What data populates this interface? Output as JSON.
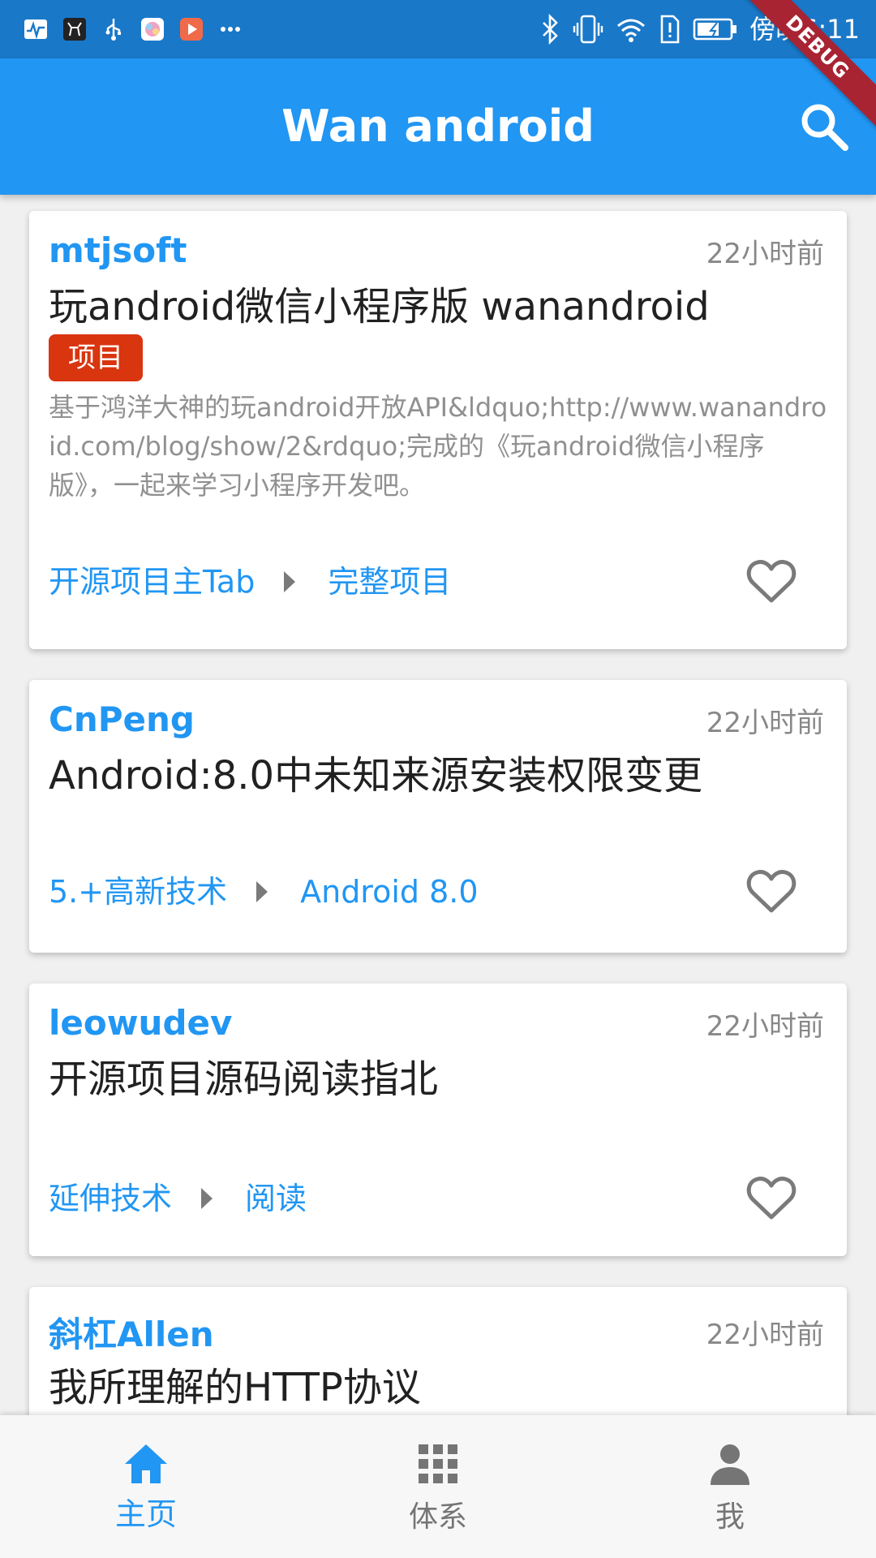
{
  "status_bar": {
    "time": "傍晚6:11",
    "left_icons": [
      "activity-monitor-icon",
      "app-icon",
      "usb-icon",
      "photos-icon",
      "video-icon",
      "more-icon"
    ],
    "right_icons": [
      "bluetooth-icon",
      "vibrate-icon",
      "wifi-icon",
      "alert-icon",
      "battery-icon"
    ]
  },
  "debug_banner": "DEBUG",
  "app_bar": {
    "title": "Wan android",
    "search_icon": "search-icon"
  },
  "articles": [
    {
      "author": "mtjsoft",
      "time": "22小时前",
      "title": "玩android微信小程序版 wanandroid",
      "tag": "项目",
      "desc": "基于鸿洋大神的玩android开放API&ldquo;http://www.wanandroid.com/blog/show/2&rdquo;完成的《玩android微信小程序版》，一起来学习小程序开发吧。",
      "chapter_parent": "开源项目主Tab",
      "chapter": "完整项目"
    },
    {
      "author": "CnPeng",
      "time": "22小时前",
      "title": "Android:8.0中未知来源安装权限变更",
      "chapter_parent": "5.+高新技术",
      "chapter": "Android 8.0"
    },
    {
      "author": "leowudev",
      "time": "22小时前",
      "title": "开源项目源码阅读指北",
      "chapter_parent": "延伸技术",
      "chapter": "阅读"
    },
    {
      "author": "斜杠Allen",
      "time": "22小时前",
      "title": "我所理解的HTTP协议"
    }
  ],
  "bottom_nav": {
    "items": [
      {
        "label": "主页",
        "icon": "home-icon",
        "active": true
      },
      {
        "label": "体系",
        "icon": "grid-icon",
        "active": false
      },
      {
        "label": "我",
        "icon": "person-icon",
        "active": false
      }
    ]
  },
  "colors": {
    "primary": "#2196F3",
    "status_bar": "#1A78C8",
    "tag_bg": "#D9350F",
    "debug_ribbon": "#A82433",
    "inactive": "#757575"
  }
}
